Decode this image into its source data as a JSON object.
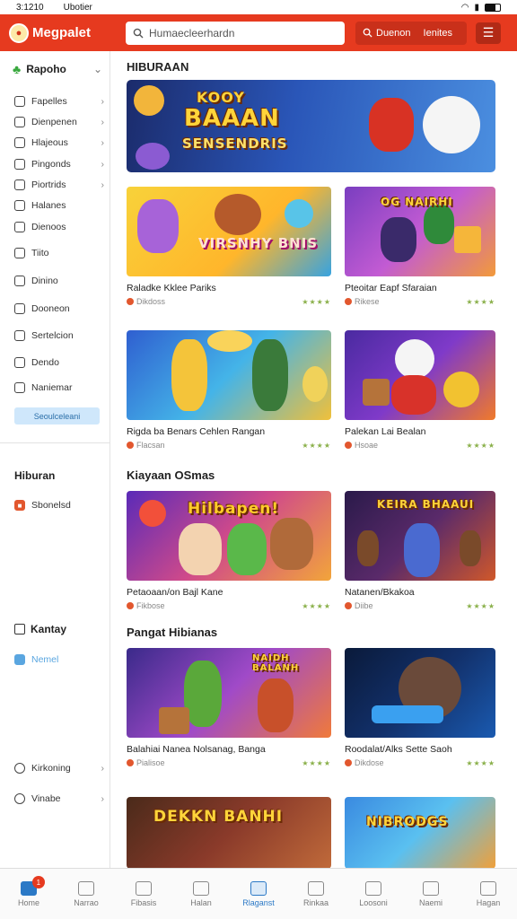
{
  "status": {
    "time": "3:1210",
    "carrier": "Ubotier"
  },
  "appbar": {
    "logo": "Megpalet",
    "search_placeholder": "Humaecleerhardn",
    "action_label": "Duenon",
    "action_label2": "Ienites",
    "colors": {
      "brand": "#e63a1f"
    }
  },
  "sidebar": {
    "head": "Rapoho",
    "items": [
      {
        "label": "Fapelles",
        "icon": "clock-icon",
        "chev": true
      },
      {
        "label": "Dienpenen",
        "icon": "gear-icon",
        "chev": true
      },
      {
        "label": "Hlajeous",
        "icon": "check-icon",
        "chev": true
      },
      {
        "label": "Pingonds",
        "icon": "grid-icon",
        "chev": true
      },
      {
        "label": "Piortrids",
        "icon": "doc-icon",
        "chev": true
      },
      {
        "label": "Halanes",
        "icon": "image-icon",
        "chev": false
      },
      {
        "label": "Dienoos",
        "icon": "search-icon",
        "chev": false
      },
      {
        "label": "Tiito",
        "icon": "smile-icon",
        "chev": false
      },
      {
        "label": "Dinino",
        "icon": "box-icon",
        "chev": false
      },
      {
        "label": "Dooneon",
        "icon": "chat-icon",
        "chev": false
      },
      {
        "label": "Sertelcion",
        "icon": "edit-icon",
        "chev": false
      },
      {
        "label": "Dendo",
        "icon": "square-icon",
        "chev": false
      },
      {
        "label": "Naniemar",
        "icon": "camera-icon",
        "chev": false
      }
    ],
    "pill": "Seoulceleani",
    "section1": "Hiburan",
    "section1_item": "Sbonelsd",
    "section2": "Kantay",
    "section2_item": "Nemel",
    "bottom_items": [
      "Kirkoning",
      "Vinabe"
    ]
  },
  "main": {
    "section_title": "HIBURAAN",
    "hero_text": [
      "KOOY",
      "BAAAN",
      "SENSENDRIS"
    ],
    "cards_row1": [
      {
        "title": "Raladke Kklee Pariks",
        "meta": "Dikdoss",
        "img_text": "VIRSNHY BNIS",
        "stars": "★★★★"
      },
      {
        "title": "Pteoitar Eapf Sfaraian",
        "meta": "Rikese",
        "img_text": "OG NAIRHI",
        "stars": "★★★★"
      }
    ],
    "cards_row2": [
      {
        "title": "Rigda ba Benars Cehlen Rangan",
        "meta": "Flacsan",
        "stars": "★★★★"
      },
      {
        "title": "Palekan Lai Bealan",
        "meta": "Hsoae",
        "stars": "★★★★"
      }
    ],
    "section2_title": "Kiayaan OSmas",
    "cards_row3": [
      {
        "title": "Petaoaan/on Bajl Kane",
        "meta": "Fikbose",
        "img_text": "Hilbapen!",
        "stars": "★★★★"
      },
      {
        "title": "Natanen/Bkakoa",
        "meta": "Diibe",
        "img_text": "KEIRA BHAAUI",
        "stars": "★★★★"
      }
    ],
    "section3_title": "Pangat Hibianas",
    "cards_row4": [
      {
        "title": "Balahiai Nanea Nolsanag, Banga",
        "meta": "Pialisoe",
        "img_text": "NAIDH BALANH",
        "stars": "★★★★"
      },
      {
        "title": "Roodalat/Alks Sette Saoh",
        "meta": "Dikdose",
        "stars": "★★★★"
      }
    ],
    "cards_row5": [
      {
        "img_text": "DEKKN BANHI"
      },
      {
        "img_text": "NIBRODGS"
      }
    ]
  },
  "bottomnav": [
    {
      "label": "Home",
      "active": false,
      "badge": "1"
    },
    {
      "label": "Narrao",
      "active": false
    },
    {
      "label": "Fibasis",
      "active": false
    },
    {
      "label": "Halan",
      "active": false
    },
    {
      "label": "Rlaganst",
      "active": true
    },
    {
      "label": "Rinkaa",
      "active": false
    },
    {
      "label": "Loosoni",
      "active": false
    },
    {
      "label": "Naemi",
      "active": false
    },
    {
      "label": "Hagan",
      "active": false
    }
  ]
}
